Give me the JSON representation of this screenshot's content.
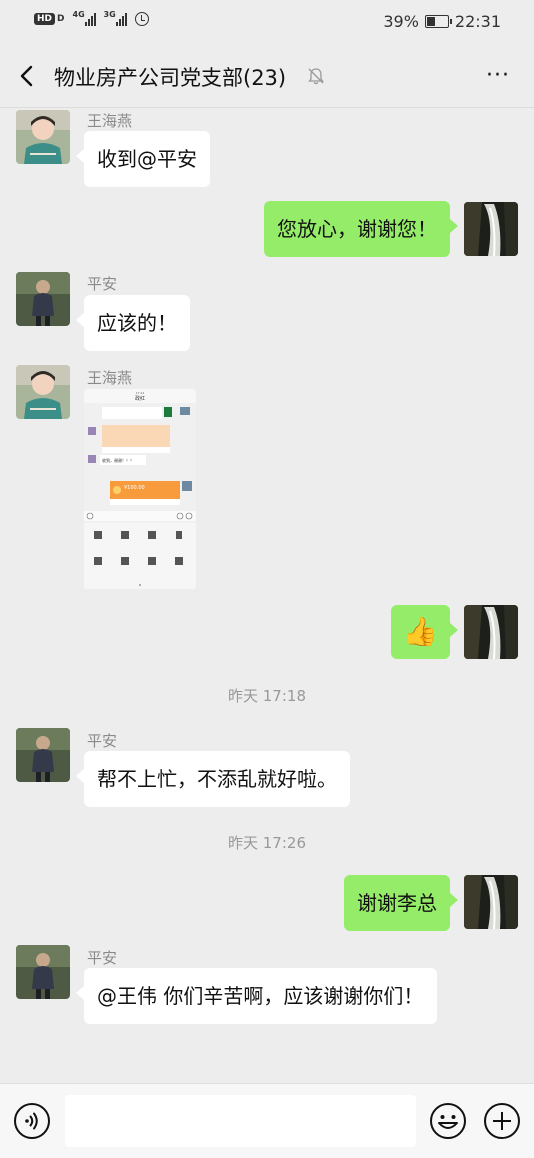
{
  "status_bar": {
    "hd_label": "HD",
    "hd_sub": "D",
    "signal1_type": "4G",
    "signal2_type": "3G",
    "battery_percent": "39%",
    "battery_level": 0.39,
    "time": "22:31"
  },
  "header": {
    "title": "物业房产公司党支部(23)",
    "more_label": "···",
    "muted": true
  },
  "messages": [
    {
      "direction": "in",
      "sender": "王海燕",
      "avatar": "avatar-wanghaiyan",
      "type": "text",
      "text": "收到@平安"
    },
    {
      "direction": "out",
      "avatar": "avatar-self-waterfall",
      "type": "text",
      "text": "您放心，谢谢您！"
    },
    {
      "direction": "in",
      "sender": "平安",
      "avatar": "avatar-pingan",
      "type": "text",
      "text": "应该的！"
    },
    {
      "direction": "in",
      "sender": "王海燕",
      "avatar": "avatar-wanghaiyan",
      "type": "image",
      "image": {
        "kind": "chat-screenshot",
        "header_title": "政红",
        "header_time": "17:14",
        "red_packet_amount": "¥100.00",
        "reply_text": "收到，谢谢！！！"
      }
    },
    {
      "direction": "out",
      "avatar": "avatar-self-waterfall",
      "type": "emoji",
      "emoji": "👍"
    },
    {
      "type": "timestamp",
      "text": "昨天 17:18"
    },
    {
      "direction": "in",
      "sender": "平安",
      "avatar": "avatar-pingan",
      "type": "text",
      "text": "帮不上忙，不添乱就好啦。"
    },
    {
      "type": "timestamp",
      "text": "昨天 17:26"
    },
    {
      "direction": "out",
      "avatar": "avatar-self-waterfall",
      "type": "text",
      "text": "谢谢李总"
    },
    {
      "direction": "in",
      "sender": "平安",
      "avatar": "avatar-pingan",
      "type": "text",
      "text": "@王伟  你们辛苦啊，应该谢谢你们！"
    }
  ],
  "input_bar": {
    "voice_icon": "voice-icon",
    "emoji_icon": "emoji-icon",
    "plus_icon": "plus-icon",
    "value": "",
    "placeholder": ""
  },
  "colors": {
    "background": "#ededed",
    "incoming_bubble": "#ffffff",
    "outgoing_bubble": "#95ec69",
    "sender_name": "#8a8a8a",
    "timestamp": "#999999"
  }
}
